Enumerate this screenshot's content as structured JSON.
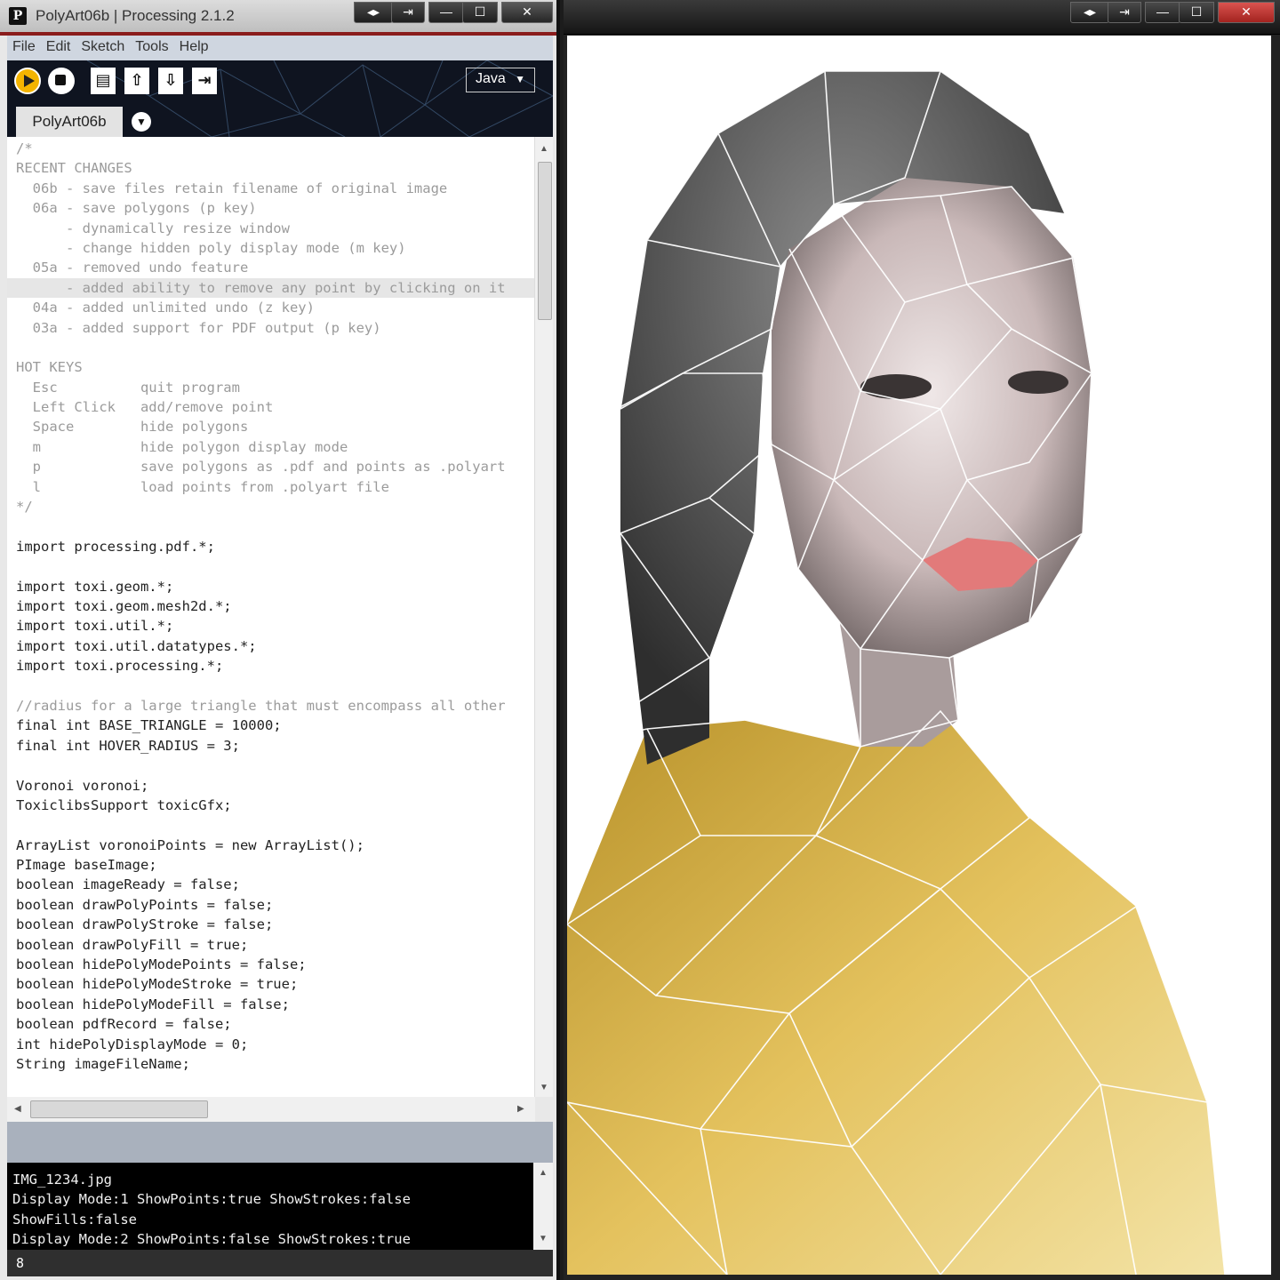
{
  "ide": {
    "title": "PolyArt06b | Processing 2.1.2",
    "app_icon": "P",
    "window_buttons": [
      "◂▸",
      "⇥",
      "—",
      "☐",
      "✕"
    ],
    "menu": [
      "File",
      "Edit",
      "Sketch",
      "Tools",
      "Help"
    ],
    "toolbar": {
      "icons": [
        "run-icon",
        "stop-icon",
        "new-icon",
        "open-icon",
        "save-icon",
        "export-icon"
      ],
      "mode": "Java",
      "mode_arrow": "▼"
    },
    "tab": {
      "label": "PolyArt06b",
      "menu_icon": "▼"
    },
    "code_lines": [
      "/*",
      "RECENT CHANGES",
      "  06b - save files retain filename of original image",
      "  06a - save polygons (p key)",
      "      - dynamically resize window",
      "      - change hidden poly display mode (m key)",
      "  05a - removed undo feature",
      "      - added ability to remove any point by clicking on it",
      "  04a - added unlimited undo (z key)",
      "  03a - added support for PDF output (p key)",
      "",
      "HOT KEYS",
      "  Esc          quit program",
      "  Left Click   add/remove point",
      "  Space        hide polygons",
      "  m            hide polygon display mode",
      "  p            save polygons as .pdf and points as .polyart",
      "  l            load points from .polyart file",
      "*/",
      "",
      "import processing.pdf.*;",
      "",
      "import toxi.geom.*;",
      "import toxi.geom.mesh2d.*;",
      "import toxi.util.*;",
      "import toxi.util.datatypes.*;",
      "import toxi.processing.*;",
      "",
      "//radius for a large triangle that must encompass all other",
      "final int BASE_TRIANGLE = 10000;",
      "final int HOVER_RADIUS = 3;",
      "",
      "Voronoi voronoi;",
      "ToxiclibsSupport toxicGfx;",
      "",
      "ArrayList voronoiPoints = new ArrayList();",
      "PImage baseImage;",
      "boolean imageReady = false;",
      "boolean drawPolyPoints = false;",
      "boolean drawPolyStroke = false;",
      "boolean drawPolyFill = true;",
      "boolean hidePolyModePoints = false;",
      "boolean hidePolyModeStroke = true;",
      "boolean hidePolyModeFill = false;",
      "boolean pdfRecord = false;",
      "int hidePolyDisplayMode = 0;",
      "String imageFileName;"
    ],
    "console_lines": [
      "IMG_1234.jpg",
      "Display Mode:1 ShowPoints:true ShowStrokes:false",
      "ShowFills:false",
      "Display Mode:2 ShowPoints:false ShowStrokes:true"
    ],
    "status_line": "8",
    "colors": {
      "comment": "#9b9b9b",
      "keyword": "#3b88c3",
      "type": "#d9730d",
      "class": "#2b6cb0",
      "run_button": "#f4b400"
    }
  },
  "sketch": {
    "window_buttons": [
      "◂▸",
      "⇥",
      "—",
      "☐",
      "✕"
    ],
    "canvas_description_icon": "portrait-mesh-image"
  }
}
